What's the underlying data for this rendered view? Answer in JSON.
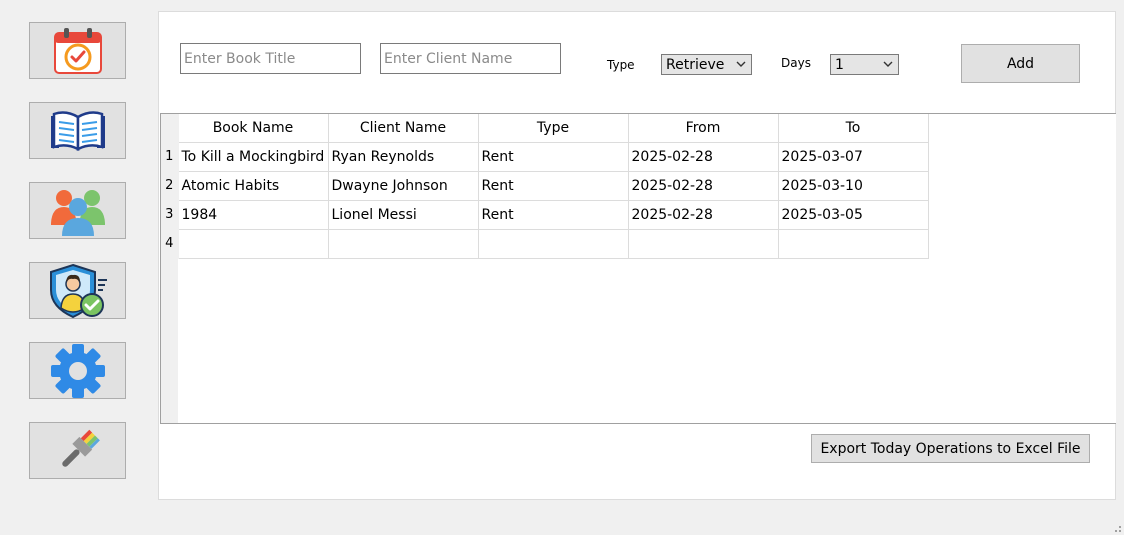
{
  "sidebar": {
    "items": [
      {
        "icon": "calendar-check-icon"
      },
      {
        "icon": "open-book-icon"
      },
      {
        "icon": "users-icon"
      },
      {
        "icon": "user-shield-icon"
      },
      {
        "icon": "gear-icon"
      },
      {
        "icon": "paint-brush-icon"
      }
    ]
  },
  "form": {
    "book_title_placeholder": "Enter Book Title",
    "book_title_value": "",
    "client_name_placeholder": "Enter Client Name",
    "client_name_value": "",
    "type_label": "Type",
    "type_selected": "Retrieve",
    "days_label": "Days",
    "days_selected": "1",
    "add_label": "Add"
  },
  "table": {
    "columns": [
      "Book Name",
      "Client Name",
      "Type",
      "From",
      "To"
    ],
    "rows": [
      {
        "num": "1",
        "cells": [
          "To Kill a Mockingbird",
          "Ryan Reynolds",
          "Rent",
          "2025-02-28",
          "2025-03-07"
        ]
      },
      {
        "num": "2",
        "cells": [
          "Atomic Habits",
          "Dwayne Johnson",
          "Rent",
          "2025-02-28",
          "2025-03-10"
        ]
      },
      {
        "num": "3",
        "cells": [
          "1984",
          "Lionel Messi",
          "Rent",
          "2025-02-28",
          "2025-03-05"
        ]
      },
      {
        "num": "4",
        "cells": [
          "",
          "",
          "",
          "",
          ""
        ]
      }
    ]
  },
  "export_label": "Export Today Operations to Excel File",
  "colors": {
    "accent_blue": "#2f8ae6",
    "calendar_red": "#e8483b",
    "check_orange": "#f59a1f",
    "button_bg": "#e1e1e1"
  }
}
